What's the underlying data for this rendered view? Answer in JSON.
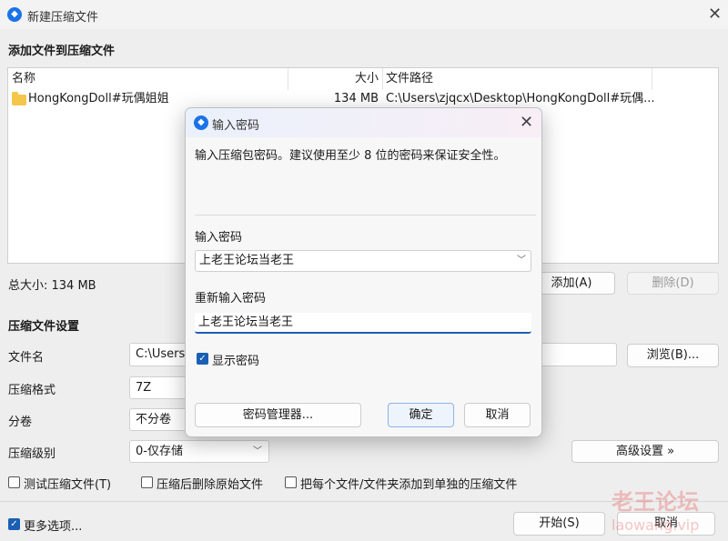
{
  "window": {
    "title": "新建压缩文件",
    "section_add": "添加文件到压缩文件",
    "columns": {
      "name": "名称",
      "size": "大小",
      "path": "文件路径"
    },
    "files": [
      {
        "name": "HongKongDoll#玩偶姐姐",
        "size": "134 MB",
        "path": "C:\\Users\\zjqcx\\Desktop\\HongKongDoll#玩偶..."
      }
    ],
    "total_size": "总大小: 134 MB",
    "add_button": "添加(A)",
    "delete_button": "删除(D)",
    "section_settings": "压缩文件设置",
    "filename_label": "文件名",
    "filename_value": "C:\\Users\\",
    "browse_button": "浏览(B)...",
    "format_label": "压缩格式",
    "format_value": "7Z",
    "split_label": "分卷",
    "split_value": "不分卷",
    "level_label": "压缩级别",
    "level_value": "0-仅存储",
    "advanced_button": "高级设置 »",
    "opt_test": "测试压缩文件(T)",
    "opt_delete": "压缩后删除原始文件",
    "opt_each": "把每个文件/文件夹添加到单独的压缩文件",
    "more_options": "更多选项...",
    "start_button": "开始(S)",
    "cancel_button": "取消"
  },
  "dialog": {
    "title": "输入密码",
    "hint": "输入压缩包密码。建议使用至少 8 位的密码来保证安全性。",
    "pwd_label": "输入密码",
    "pwd_value": "上老王论坛当老王",
    "repwd_label": "重新输入密码",
    "repwd_value": "上老王论坛当老王",
    "show_password": "显示密码",
    "manager_button": "密码管理器...",
    "ok_button": "确定",
    "cancel_button": "取消"
  },
  "watermark": {
    "line1": "老王论坛",
    "line2": "laowang.vip"
  },
  "icons": {
    "app": "app-logo-icon",
    "close": "close-icon",
    "folder": "folder-icon",
    "dropdown": "chevron-down-icon",
    "check": "checkmark-icon"
  },
  "colors": {
    "accent": "#1a5fb4",
    "watermark": "#e65a5a"
  }
}
